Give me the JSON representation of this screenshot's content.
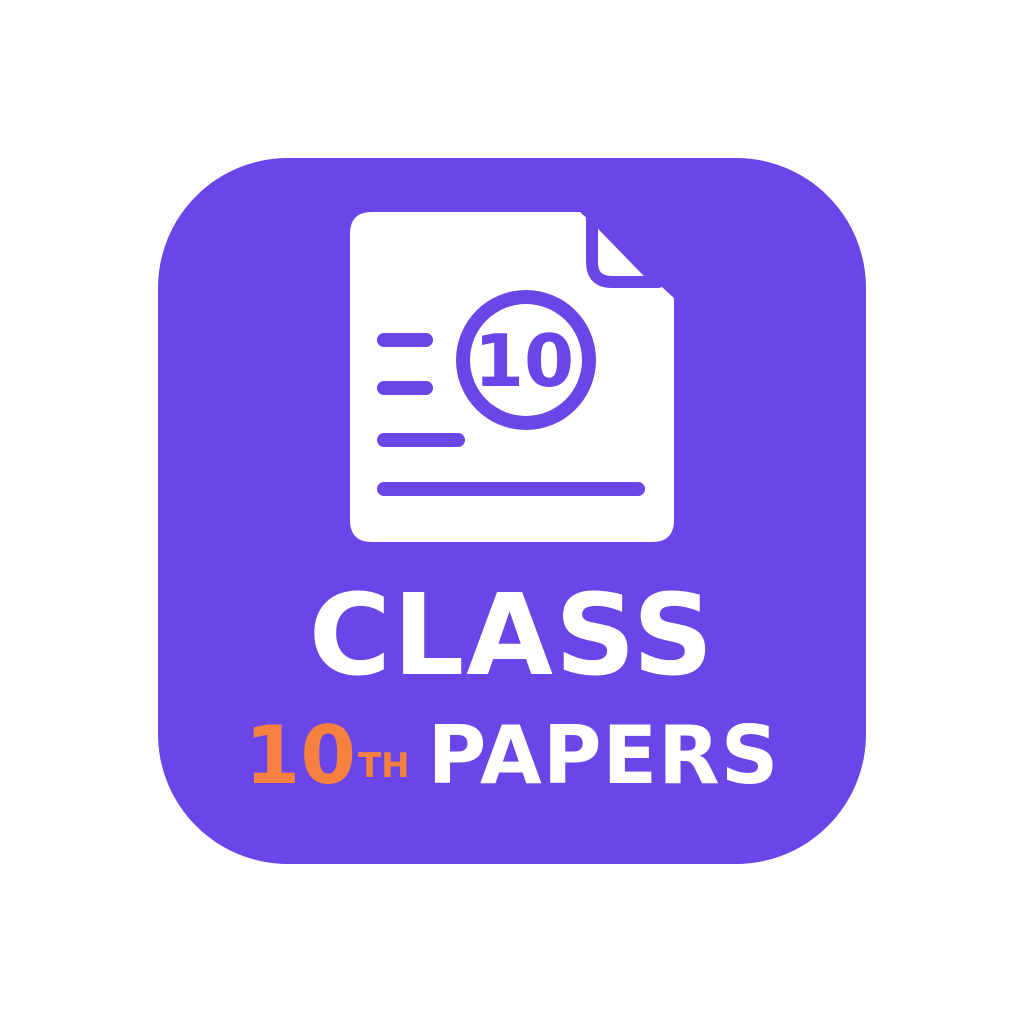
{
  "icon": {
    "background_color": "#6a45e8",
    "foreground_color": "#ffffff",
    "accent_color": "#f6803f",
    "document_icon": "document-icon",
    "badge_number": "10"
  },
  "title": {
    "line1": "CLASS",
    "grade_number": "10",
    "grade_suffix": "TH",
    "line2_word": "PAPERS"
  }
}
